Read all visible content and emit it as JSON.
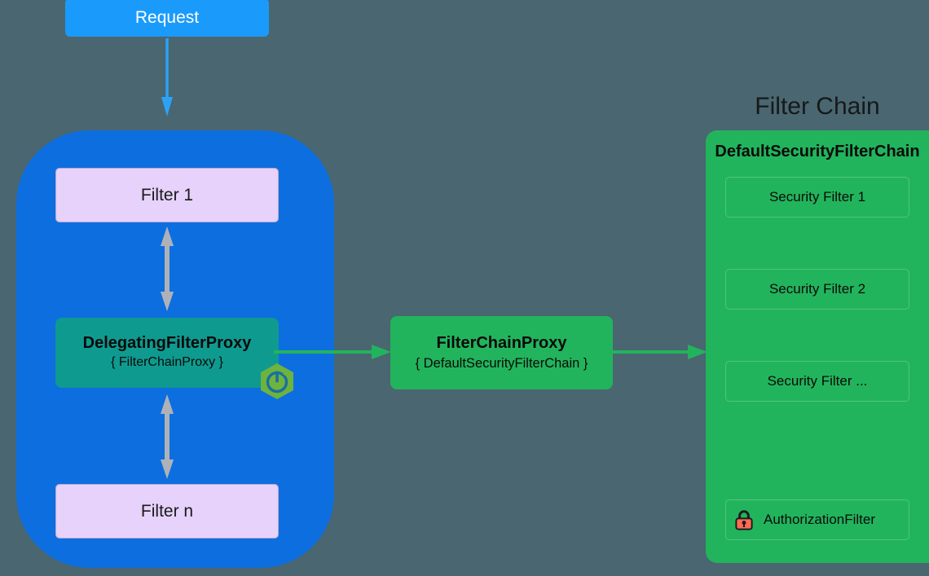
{
  "background_color": "#4a6670",
  "request": {
    "label": "Request",
    "color": "#1a9bfc"
  },
  "servlet_container": {
    "color": "#0d6ee0",
    "filters": [
      {
        "label": "Filter 1",
        "color": "#e6d2fb"
      },
      {
        "label": "Filter n",
        "color": "#e6d2fb"
      }
    ],
    "delegating_proxy": {
      "title": "DelegatingFilterProxy",
      "subtitle": "{ FilterChainProxy }",
      "color": "#0f9a90",
      "badge_icon": "spring-boot-icon"
    },
    "arrows": [
      {
        "icon": "double-headed-arrow-icon",
        "color": "#aeb2b8"
      },
      {
        "icon": "double-headed-arrow-icon",
        "color": "#aeb2b8"
      }
    ]
  },
  "filter_chain_proxy": {
    "title": "FilterChainProxy",
    "subtitle": "{ DefaultSecurityFilterChain }",
    "color": "#22b45c"
  },
  "connectors": {
    "request_to_container": {
      "icon": "arrow-down-icon",
      "color": "#2aa3f7"
    },
    "proxy_to_fcp": {
      "icon": "arrow-right-icon",
      "color": "#22b45c"
    },
    "fcp_to_chain": {
      "icon": "arrow-right-icon",
      "color": "#22b45c"
    }
  },
  "filter_chain": {
    "title": "Filter Chain",
    "panel_title": "DefaultSecurityFilterChain",
    "color": "#22b45c",
    "filters": [
      {
        "label": "Security Filter 1",
        "icon": null
      },
      {
        "label": "Security Filter 2",
        "icon": null
      },
      {
        "label": "Security Filter ...",
        "icon": null
      },
      {
        "label": "AuthorizationFilter",
        "icon": "lock-icon"
      }
    ]
  }
}
